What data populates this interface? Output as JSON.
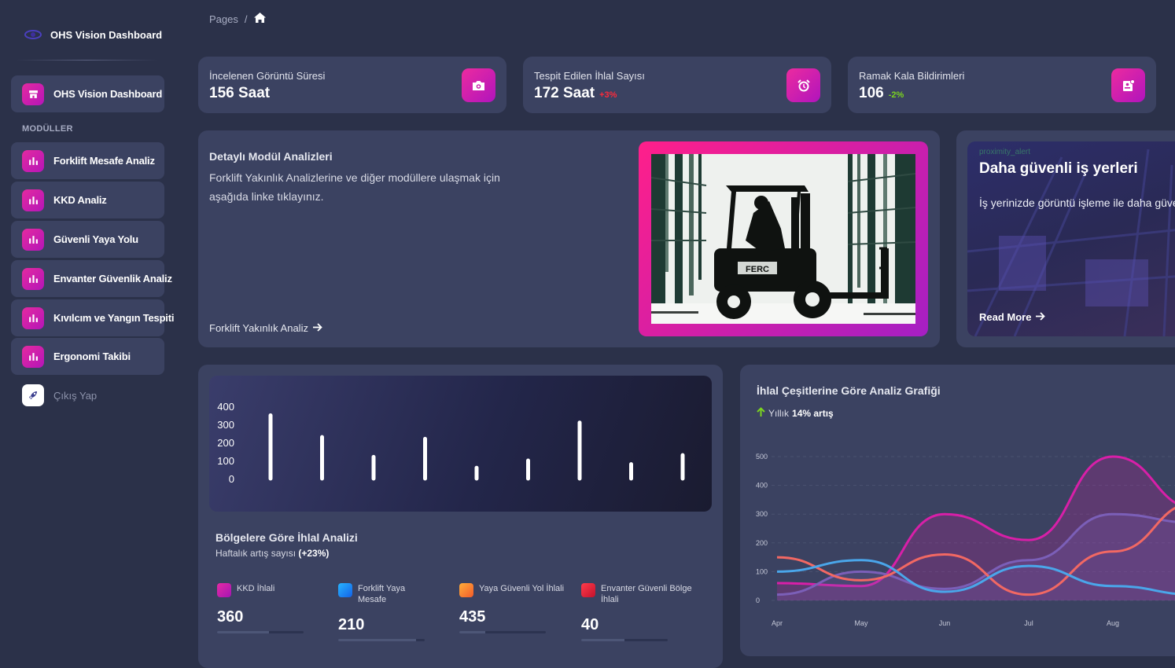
{
  "sidebar": {
    "brand": "OHS Vision Dashboard",
    "active_item": "OHS Vision Dashboard",
    "section_label": "MODÜLLER",
    "items": [
      {
        "label": "Forklift Mesafe Analiz"
      },
      {
        "label": "KKD Analiz"
      },
      {
        "label": "Güvenli Yaya Yolu"
      },
      {
        "label": "Envanter Güvenlik Analiz"
      },
      {
        "label": "Kıvılcım ve Yangın Tespiti"
      },
      {
        "label": "Ergonomi Takibi"
      }
    ],
    "logout": "Çıkış Yap"
  },
  "breadcrumb": {
    "pages": "Pages",
    "sep": "/",
    "home_icon": "home-icon"
  },
  "stats": [
    {
      "label": "İncelenen Görüntü Süresi",
      "value": "156 Saat",
      "change": "",
      "icon": "camera-icon"
    },
    {
      "label": "Tespit Edilen İhlal Sayısı",
      "value": "172 Saat",
      "change": "+3%",
      "change_color": "#ff2a3a",
      "icon": "alarm-clock-icon"
    },
    {
      "label": "Ramak Kala Bildirimleri",
      "value": "106",
      "change": "-2%",
      "change_color": "#7bd41f",
      "icon": "notification-icon"
    }
  ],
  "detail": {
    "title": "Detaylı Modül Analizleri",
    "description": "Forklift Yakınlık Analizlerine ve diğer modüllere ulaşmak için aşağıda linke tıklayınız.",
    "link": "Forklift Yakınlık Analiz",
    "image": "forklift-illustration",
    "image_lettering": "FERC"
  },
  "promo": {
    "overlay_text": "proximity_alert",
    "title": "Daha güvenli iş yerleri",
    "text": "İş yerinizde görüntü işleme ile daha güvenli",
    "link": "Read More"
  },
  "bar_section": {
    "title": "Bölgelere Göre İhlal Analizi",
    "subtitle_prefix": "Haftalık artış sayısı",
    "subtitle_value": "(+23%)"
  },
  "metrics": [
    {
      "label": "KKD İhlali",
      "value": "360",
      "color": "#d41fa6",
      "progress": 0.6
    },
    {
      "label": "Forklift Yaya Mesafe",
      "value": "210",
      "color": "#1b8cf5",
      "progress": 0.9
    },
    {
      "label": "Yaya Güvenli Yol İhlali",
      "value": "435",
      "color": "#f5862a",
      "progress": 0.3
    },
    {
      "label": "Envanter Güvenli Bölge İhlali",
      "value": "40",
      "color": "#e8203c",
      "progress": 0.5
    }
  ],
  "line_section": {
    "title": "İhlal Çeşitlerine Göre Analiz Grafiği",
    "subtitle_prefix": "Yıllık",
    "subtitle_value": "14% artış"
  },
  "chart_data": [
    {
      "type": "bar",
      "title": "",
      "categories": [
        "",
        "",
        "",
        "",
        "",
        "",
        "",
        "",
        ""
      ],
      "values": [
        350,
        230,
        120,
        220,
        60,
        100,
        310,
        80,
        130
      ],
      "yticks": [
        0,
        100,
        200,
        300,
        400
      ],
      "ylim": [
        0,
        400
      ],
      "bar_color": "#ffffff",
      "grid": false
    },
    {
      "type": "line",
      "title": "",
      "categories": [
        "Apr",
        "May",
        "Jun",
        "Jul",
        "Aug"
      ],
      "yticks": [
        0,
        100,
        200,
        300,
        400,
        500
      ],
      "ylim": [
        0,
        500
      ],
      "grid": true,
      "series": [
        {
          "color": "#d81fa8",
          "fill": true,
          "values": [
            60,
            50,
            300,
            210,
            500,
            320
          ]
        },
        {
          "color": "#7b5fb8",
          "fill": true,
          "values": [
            20,
            100,
            40,
            140,
            300,
            270
          ]
        },
        {
          "color": "#f26863",
          "fill": false,
          "values": [
            150,
            70,
            160,
            20,
            170,
            340
          ]
        },
        {
          "color": "#4aa6ea",
          "fill": false,
          "values": [
            100,
            140,
            30,
            120,
            50,
            20
          ]
        }
      ]
    }
  ]
}
